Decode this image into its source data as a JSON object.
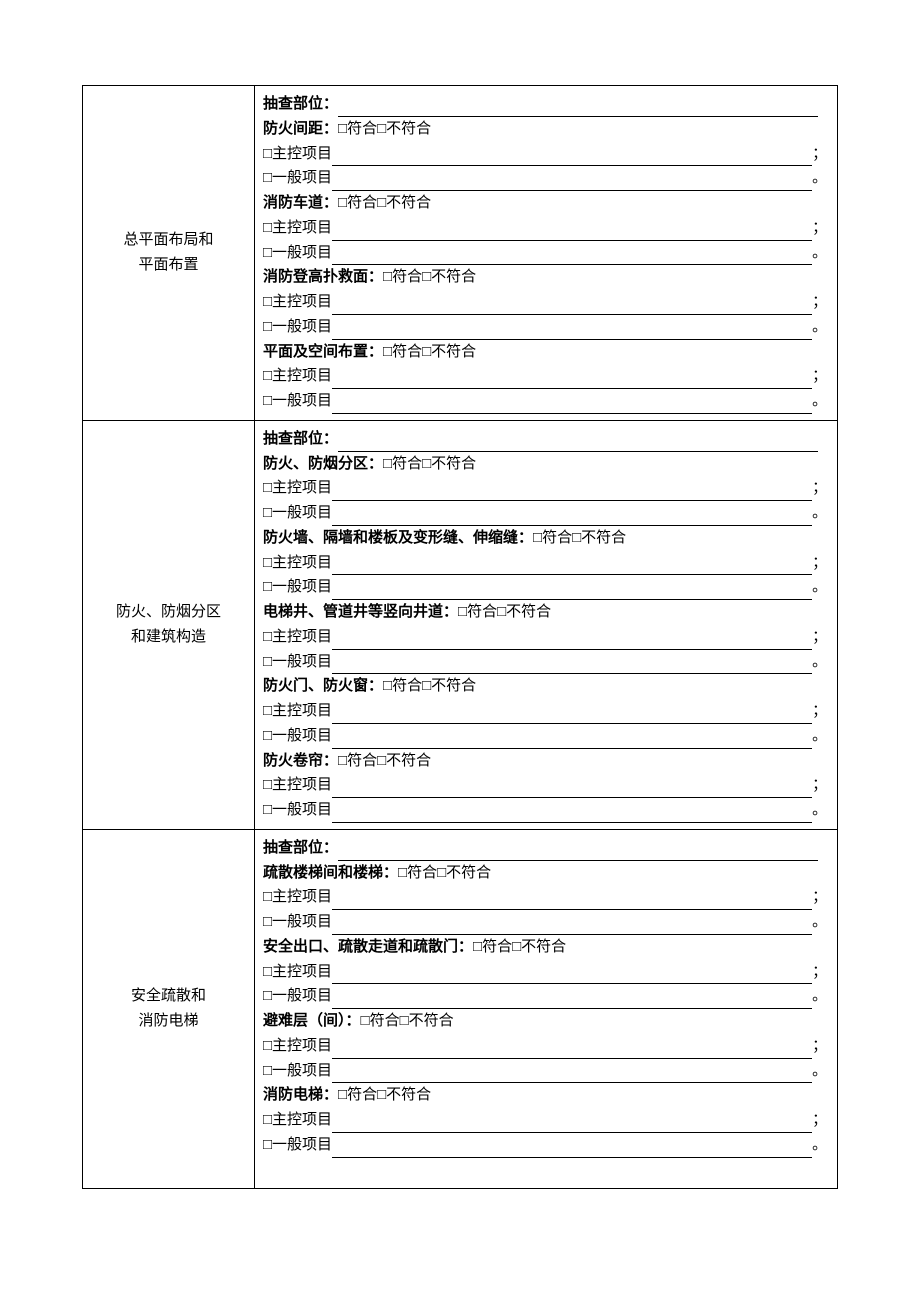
{
  "common": {
    "inspectLabel": "抽查部位：",
    "compliance": "□符合□不符合",
    "mainItemPrefix": "□主控项目",
    "generalItemPrefix": "□一般项目",
    "mainSuffix": "；",
    "generalSuffix": "。"
  },
  "sections": [
    {
      "label": "总平面布局和\n平面布置",
      "items": [
        {
          "title": "防火间距："
        },
        {
          "title": "消防车道："
        },
        {
          "title": "消防登高扑救面："
        },
        {
          "title": "平面及空间布置："
        }
      ]
    },
    {
      "label": "防火、防烟分区\n和建筑构造",
      "items": [
        {
          "title": "防火、防烟分区："
        },
        {
          "title": "防火墙、隔墙和楼板及变形缝、伸缩缝："
        },
        {
          "title": "电梯井、管道井等竖向井道："
        },
        {
          "title": "防火门、防火窗："
        },
        {
          "title": "防火卷帘："
        }
      ]
    },
    {
      "label": "安全疏散和\n消防电梯",
      "items": [
        {
          "title": "疏散楼梯间和楼梯："
        },
        {
          "title": "安全出口、疏散走道和疏散门："
        },
        {
          "title": "避难层（间）："
        },
        {
          "title": "消防电梯："
        }
      ],
      "trailingBlank": true
    }
  ]
}
